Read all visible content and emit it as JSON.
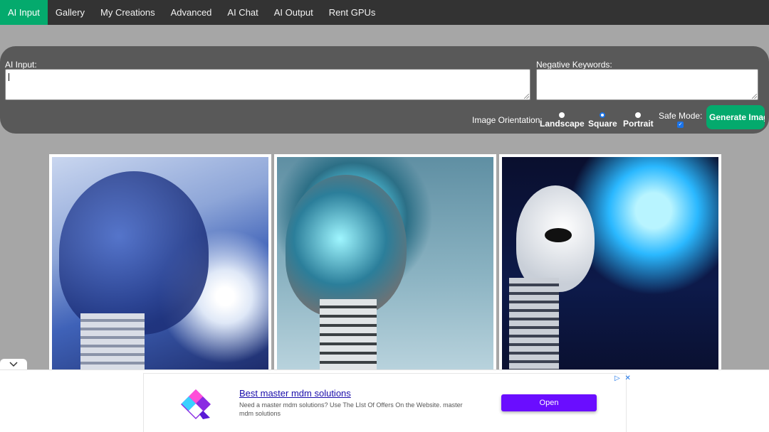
{
  "nav": {
    "items": [
      {
        "label": "AI Input",
        "active": true
      },
      {
        "label": "Gallery"
      },
      {
        "label": "My Creations"
      },
      {
        "label": "Advanced"
      },
      {
        "label": "AI Chat"
      },
      {
        "label": "AI Output"
      },
      {
        "label": "Rent GPUs"
      }
    ]
  },
  "form": {
    "ai_input_label": "AI Input:",
    "ai_input_value": "",
    "negative_label": "Negative Keywords:",
    "negative_value": "",
    "orientation_label": "Image Orientation:",
    "orientations": [
      {
        "label": "Landscape",
        "checked": false
      },
      {
        "label": "Square",
        "checked": true
      },
      {
        "label": "Portrait",
        "checked": false
      }
    ],
    "safe_mode_label": "Safe Mode:",
    "safe_mode_checked": true,
    "generate_label": "Generate Image"
  },
  "gallery": {
    "images": [
      {
        "icon": "robot-head-network-image"
      },
      {
        "icon": "robot-head-glowing-brain-image"
      },
      {
        "icon": "humanoid-robot-sphere-image"
      }
    ]
  },
  "ad": {
    "title": "Best master mdm solutions",
    "description": "Need a master mdm solutions? Use The LIst Of Offers On the Website. master mdm solutions",
    "open_label": "Open",
    "adchoices_icon": "▷",
    "close_icon": "✕",
    "collapse_icon": "chevron-down-icon",
    "accent_color": "#6a0dff"
  },
  "colors": {
    "nav_bg": "#333333",
    "active_tab": "#04aa6d",
    "panel_bg": "#595959",
    "page_bg": "#a6a6a6"
  }
}
